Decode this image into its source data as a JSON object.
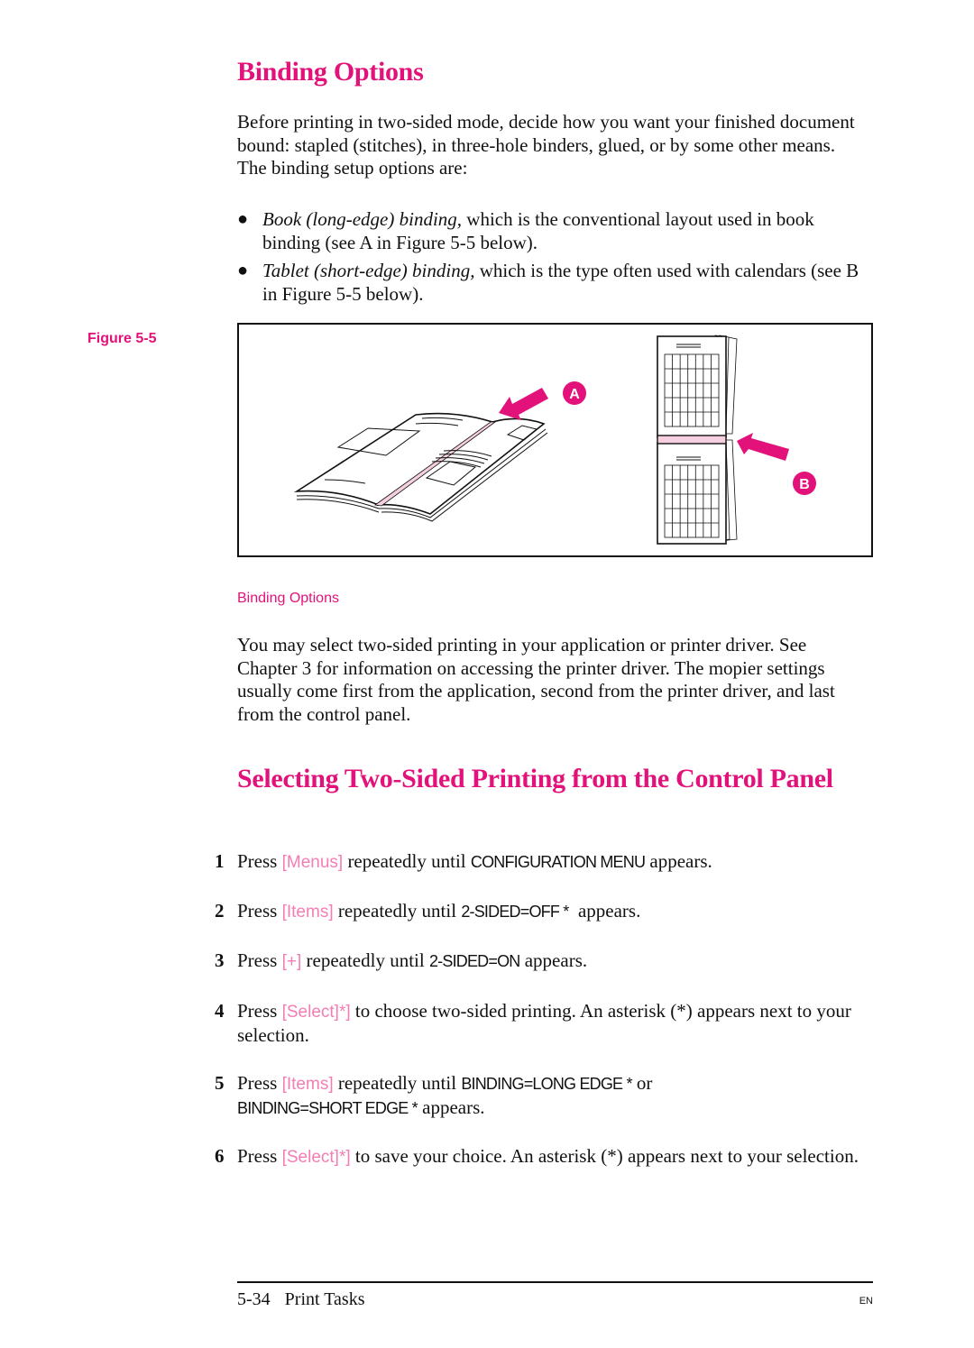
{
  "section1": {
    "title": "Binding Options",
    "intro": "Before printing in two-sided mode, decide how you want your finished document bound: stapled (stitches), in three-hole binders, glued, or by some other means. The binding setup options are:",
    "bullets": [
      {
        "em": "Book (long-edge) binding,",
        "text": " which is the conventional layout used in book binding (see A in Figure 5-5 below)."
      },
      {
        "em": "Tablet (short-edge) binding,",
        "text": " which is the type often used with calendars (see B in Figure 5-5 below)."
      }
    ]
  },
  "figure": {
    "label": "Figure 5-5",
    "caption": "Binding Options",
    "callout_a": "A",
    "callout_b": "B",
    "accent_color": "#e2127a",
    "spine_color": "#f6cfe0"
  },
  "section1_after": "You may select two-sided printing in your application or printer driver. See Chapter 3 for information on accessing the printer driver. The mopier settings usually come first from the application, second from the printer driver, and last from the control panel.",
  "section2": {
    "title": "Selecting Two-Sided Printing from the Control Panel",
    "steps": [
      {
        "num": "1",
        "pre": "Press ",
        "key": "[Menus]",
        "mid": " repeatedly until ",
        "disp": "CONFIGURATION MENU",
        "post": " appears."
      },
      {
        "num": "2",
        "pre": "Press ",
        "key": "[Items]",
        "mid": " repeatedly until ",
        "disp": "2-SIDED=OFF *",
        "post": "  appears."
      },
      {
        "num": "3",
        "pre": "Press ",
        "key": "[+]",
        "mid": " repeatedly until ",
        "disp": "2-SIDED=ON",
        "post": " appears."
      },
      {
        "num": "4",
        "pre": "Press ",
        "key": "[Select]*]",
        "mid": " to choose two-sided printing. An asterisk (*) appears next to your selection.",
        "disp": "",
        "post": ""
      },
      {
        "num": "5",
        "pre": "Press ",
        "key": "[Items]",
        "mid": " repeatedly until ",
        "disp": "BINDING=LONG EDGE *",
        "post": " or",
        "disp2": "BINDING=SHORT EDGE *",
        "post2": " appears."
      },
      {
        "num": "6",
        "pre": "Press ",
        "key": "[Select]*]",
        "mid": " to save your choice. An asterisk (*) appears next to your selection.",
        "disp": "",
        "post": ""
      }
    ]
  },
  "footer": {
    "page": "5-34",
    "section": "Print Tasks",
    "lang": "EN"
  }
}
